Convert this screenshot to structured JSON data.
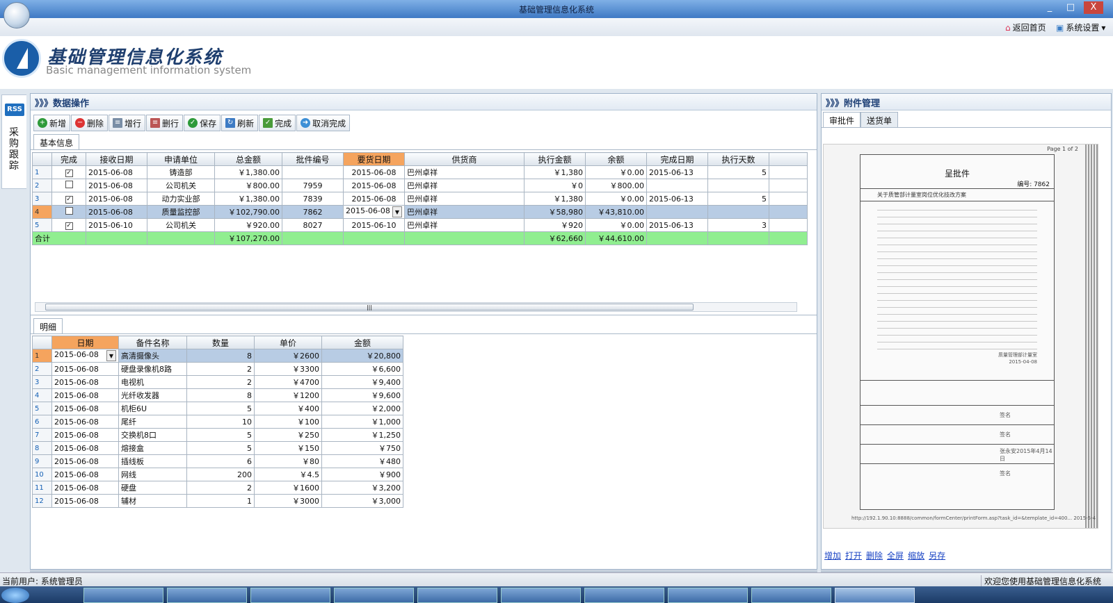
{
  "window": {
    "title": "基础管理信息化系统",
    "controls": [
      "_",
      "□",
      "X"
    ]
  },
  "menubar": {
    "home": "返回首页",
    "settings": "系统设置"
  },
  "brand": {
    "cn": "基础管理信息化系统",
    "en": "Basic management information system"
  },
  "sidetab": {
    "rss": "RSS",
    "label": "采购跟踪"
  },
  "left": {
    "title": "》》》数据操作",
    "toolbar": [
      "新增",
      "删除",
      "增行",
      "删行",
      "保存",
      "刷新",
      "完成",
      "取消完成"
    ],
    "tab_basic": "基本信息",
    "tab_detail": "明细",
    "main_cols": [
      "完成",
      "接收日期",
      "申请单位",
      "总金额",
      "批件编号",
      "要货日期",
      "供货商",
      "执行金额",
      "余额",
      "完成日期",
      "执行天数"
    ],
    "main_rows": [
      {
        "n": "1",
        "done": "✓",
        "recv": "2015-06-08",
        "unit": "铸造部",
        "total": "￥1,380.00",
        "no": "",
        "need": "2015-06-08",
        "sup": "巴州卓祥",
        "exec": "￥1,380",
        "bal": "￥0.00",
        "fin": "2015-06-13",
        "days": "5"
      },
      {
        "n": "2",
        "done": "",
        "recv": "2015-06-08",
        "unit": "公司机关",
        "total": "￥800.00",
        "no": "7959",
        "need": "2015-06-08",
        "sup": "巴州卓祥",
        "exec": "￥0",
        "bal": "￥800.00",
        "fin": "",
        "days": ""
      },
      {
        "n": "3",
        "done": "✓",
        "recv": "2015-06-08",
        "unit": "动力实业部",
        "total": "￥1,380.00",
        "no": "7839",
        "need": "2015-06-08",
        "sup": "巴州卓祥",
        "exec": "￥1,380",
        "bal": "￥0.00",
        "fin": "2015-06-13",
        "days": "5"
      },
      {
        "n": "4",
        "done": "",
        "recv": "2015-06-08",
        "unit": "质量监控部",
        "total": "￥102,790.00",
        "no": "7862",
        "need": "2015-06-08",
        "sup": "巴州卓祥",
        "exec": "￥58,980",
        "bal": "￥43,810.00",
        "fin": "",
        "days": ""
      },
      {
        "n": "5",
        "done": "✓",
        "recv": "2015-06-10",
        "unit": "公司机关",
        "total": "￥920.00",
        "no": "8027",
        "need": "2015-06-10",
        "sup": "巴州卓祥",
        "exec": "￥920",
        "bal": "￥0.00",
        "fin": "2015-06-13",
        "days": "3"
      }
    ],
    "totals": {
      "label": "合计",
      "total": "￥107,270.00",
      "exec": "￥62,660",
      "bal": "￥44,610.00"
    },
    "detail_cols": [
      "日期",
      "备件名称",
      "数量",
      "单价",
      "金额"
    ],
    "detail_rows": [
      [
        "1",
        "2015-06-08",
        "高清摄像头",
        "8",
        "￥2600",
        "￥20,800"
      ],
      [
        "2",
        "2015-06-08",
        "硬盘录像机8路",
        "2",
        "￥3300",
        "￥6,600"
      ],
      [
        "3",
        "2015-06-08",
        "电视机",
        "2",
        "￥4700",
        "￥9,400"
      ],
      [
        "4",
        "2015-06-08",
        "光纤收发器",
        "8",
        "￥1200",
        "￥9,600"
      ],
      [
        "5",
        "2015-06-08",
        "机柜6U",
        "5",
        "￥400",
        "￥2,000"
      ],
      [
        "6",
        "2015-06-08",
        "尾纤",
        "10",
        "￥100",
        "￥1,000"
      ],
      [
        "7",
        "2015-06-08",
        "交换机8口",
        "5",
        "￥250",
        "￥1,250"
      ],
      [
        "8",
        "2015-06-08",
        "熔接盒",
        "5",
        "￥150",
        "￥750"
      ],
      [
        "9",
        "2015-06-08",
        "插线板",
        "6",
        "￥80",
        "￥480"
      ],
      [
        "10",
        "2015-06-08",
        "网线",
        "200",
        "￥4.5",
        "￥900"
      ],
      [
        "11",
        "2015-06-08",
        "硬盘",
        "2",
        "￥1600",
        "￥3,200"
      ],
      [
        "12",
        "2015-06-08",
        "辅材",
        "1",
        "￥3000",
        "￥3,000"
      ]
    ]
  },
  "right": {
    "title": "》》》附件管理",
    "tabs": [
      "审批件",
      "送货单"
    ],
    "doc": {
      "page": "Page 1 of 2",
      "heading": "呈批件",
      "number": "编号: 7862",
      "subject": "关于质管部计量室岗位优化技改方案",
      "date": "2015-04-08",
      "dept": "质量管理部计量室",
      "sig_label": "签名",
      "approval_date": "张永安2015年4月14日",
      "url": "http://192.1.90.10:8888/common/formCenter/printForm.asp?task_id=&template_id=400... 2015-5-4"
    },
    "links": [
      "增加",
      "打开",
      "删除",
      "全屏",
      "缩放",
      "另存"
    ]
  },
  "status": {
    "user": "当前用户: 系统管理员",
    "welcome": "欢迎您使用基础管理信息化系统"
  }
}
